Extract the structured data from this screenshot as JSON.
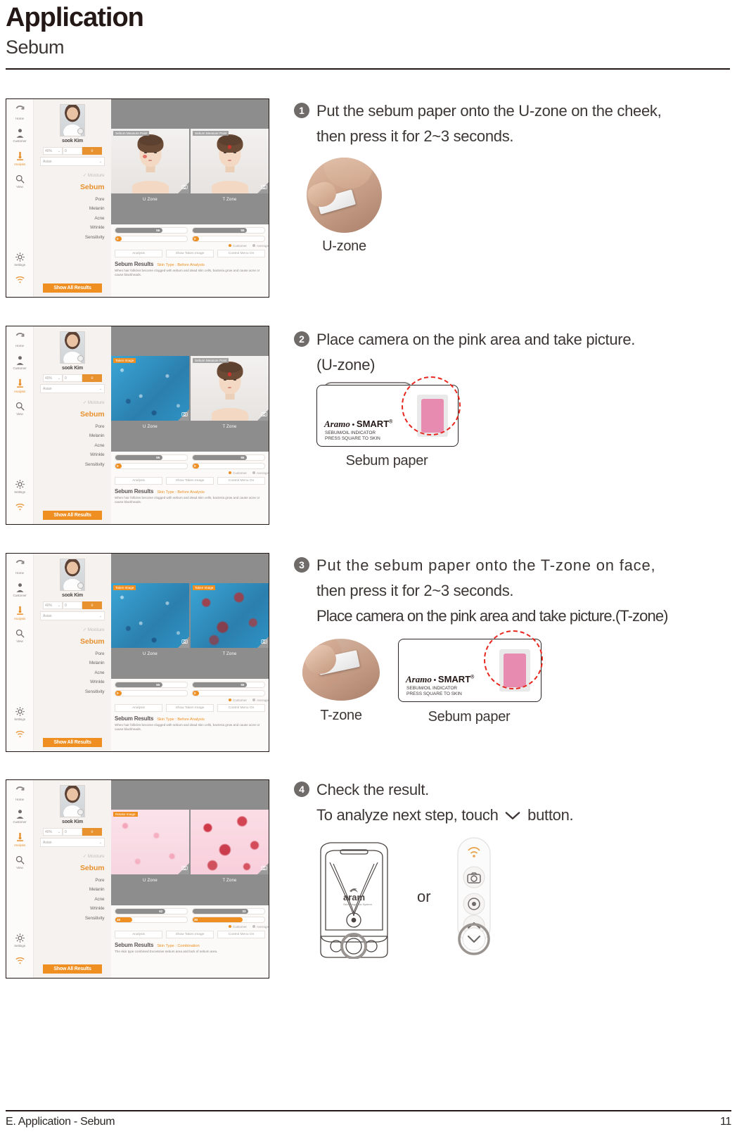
{
  "header": {
    "title": "Application",
    "subtitle": "Sebum"
  },
  "footer": {
    "left": "E. Application - Sebum",
    "page": "11"
  },
  "steps": [
    {
      "number": "1",
      "line1": "Put the sebum paper onto the U-zone on the cheek,",
      "line2": "then press it for 2~3 seconds.",
      "caption": "U-zone"
    },
    {
      "number": "2",
      "line1": "Place camera on the pink area and take picture.",
      "line2": "(U-zone)",
      "caption": "Sebum paper"
    },
    {
      "number": "3",
      "line1": "Put the sebum paper onto the T-zone on face,",
      "line2": "then press it for 2~3 seconds.",
      "line3": "Place camera on the pink area and take picture.(T-zone)",
      "caption_left": "T-zone",
      "caption_right": "Sebum paper"
    },
    {
      "number": "4",
      "line1": "Check the result.",
      "line2_pre": "To analyze next step, touch",
      "line2_post": "button.",
      "or_label": "or"
    }
  ],
  "sebum_paper": {
    "brand_italic": "Aramo",
    "brand_sep": "•",
    "brand_bold": "SMART",
    "brand_reg": "®",
    "fine_line1": "SEBUM/OIL INDICATOR",
    "fine_line2": "PRESS SQUARE TO SKIN"
  },
  "device": {
    "logo": "aram",
    "logo_sub": "Skin Diagnosis System"
  },
  "app": {
    "rail": [
      {
        "label": "Home",
        "icon": "home-icon"
      },
      {
        "label": "Customer",
        "icon": "person-icon"
      },
      {
        "label": "Analysis",
        "icon": "microscope-icon"
      },
      {
        "label": "View",
        "icon": "search-icon"
      }
    ],
    "rail_bottom": [
      {
        "label": "Settings",
        "icon": "gear-icon"
      },
      {
        "label": "",
        "icon": "wifi-icon"
      }
    ],
    "customer_name": "sook Kim",
    "zoom_value": "40%",
    "count_value": "0",
    "ethnicity": "Asian",
    "menu": [
      {
        "label": "Moisture",
        "state": "muted"
      },
      {
        "label": "Sebum",
        "state": "selected"
      },
      {
        "label": "Pore",
        "state": "normal"
      },
      {
        "label": "Melanin",
        "state": "normal"
      },
      {
        "label": "Acne",
        "state": "normal"
      },
      {
        "label": "Wrinkle",
        "state": "normal"
      },
      {
        "label": "Sensitivity",
        "state": "normal"
      }
    ],
    "show_all": "Show All Results",
    "pane_tag": "Sebum Measure Point",
    "pane_tag_taken": "Taken Image",
    "pane_tag_retake": "Retake Image",
    "zone_left": "U Zone",
    "zone_right": "T Zone",
    "bar_value_left": "55",
    "bar_value_right": "55",
    "bar_small_value": "0",
    "legend_customer": "Customer",
    "legend_average": "Average",
    "btn_analysis": "Analysis",
    "btn_show_taken": "Show Taken Image",
    "btn_control": "Control Menu On",
    "results_title": "Sebum Results",
    "results_subtitle_before": "Skin Type : Before Analysis",
    "results_subtitle_after": "Skin Type : Combination",
    "results_body_before": "When hair follicles become clogged with sebum and dead skin cells, bacteria grow and cause acne or cause blackheads.",
    "results_body_after": "The skin type combined Excessive sebum area and lack of sebum area.",
    "bar_value_left_final": "62",
    "bar_value_right_final": "33",
    "bar_small_left_final": "45",
    "bar_small_right_final": "30",
    "legend_analysis": "Analysis",
    "colors": {
      "accent": "#ef8f21",
      "panel": "#8d8d8d",
      "text": "#6f6a67"
    }
  }
}
